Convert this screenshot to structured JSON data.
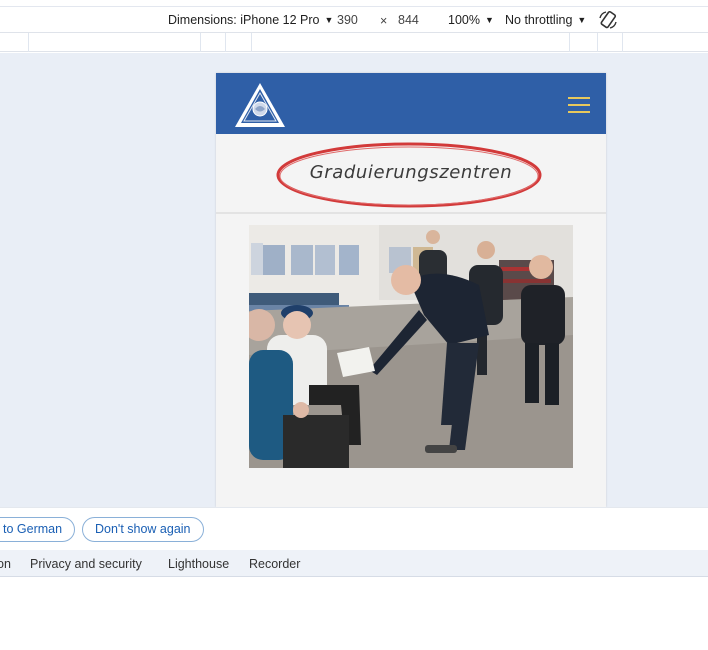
{
  "toolbar": {
    "dimensions_label": "Dimensions: iPhone 12 Pro",
    "width_value": "390",
    "times_sign": "×",
    "height_value": "844",
    "zoom": "100%",
    "throttling": "No throttling",
    "rotate_icon": "rotate-icon"
  },
  "site": {
    "header_color": "#2f5fa7",
    "menu_color": "#e7c85c",
    "logo_icon": "triangle-logo-icon",
    "menu_icon": "hamburger-icon",
    "page_title": "Graduierungszentren",
    "highlight_color": "#d23a3a"
  },
  "infobar": {
    "translate_label": "to German",
    "dont_show_label": "Don't show again"
  },
  "devtools_tabs": [
    {
      "label": "on"
    },
    {
      "label": "Privacy and security"
    },
    {
      "label": "Lighthouse"
    },
    {
      "label": "Recorder"
    }
  ]
}
